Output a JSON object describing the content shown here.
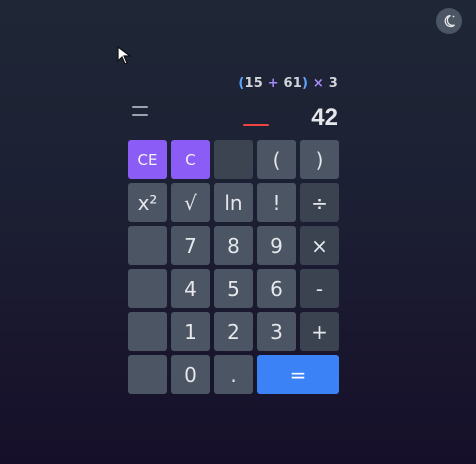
{
  "header": {
    "theme_toggle_icon": "moon-sun-icon"
  },
  "display": {
    "expression": {
      "open": "(",
      "a": "15",
      "plus": "+",
      "b": "61",
      "close": ")",
      "times": "×",
      "c": "3"
    },
    "result": "42",
    "menu_icon": "equals-icon",
    "error_color": "#ef4444"
  },
  "keypad": {
    "rows": [
      [
        "CE",
        "C",
        "",
        "(",
        ")"
      ],
      [
        "x²",
        "√",
        "ln",
        "!",
        "÷"
      ],
      [
        "",
        "7",
        "8",
        "9",
        "×"
      ],
      [
        "",
        "4",
        "5",
        "6",
        "-"
      ],
      [
        "",
        "1",
        "2",
        "3",
        "+"
      ],
      [
        "",
        "0",
        ".",
        "="
      ]
    ]
  },
  "colors": {
    "accent_purple": "#8b5cf6",
    "accent_blue": "#3b82f6",
    "key_gray": "#4b5563"
  }
}
